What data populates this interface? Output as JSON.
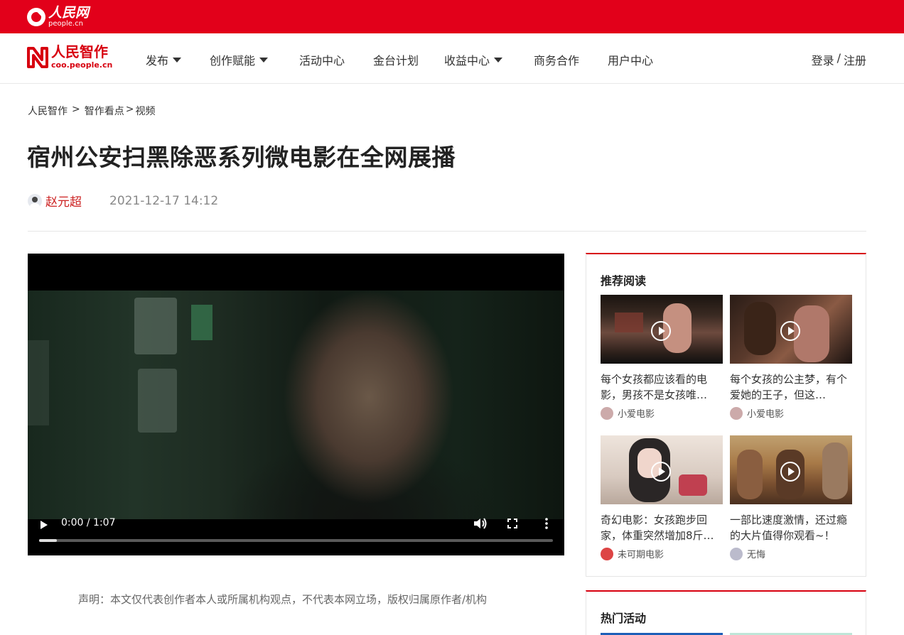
{
  "topbar": {
    "logo_cn": "人民网",
    "logo_en": "people.cn"
  },
  "brand": {
    "cn": "人民智作",
    "en": "coo.people.cn"
  },
  "nav": {
    "items": [
      {
        "label": "发布",
        "dropdown": true
      },
      {
        "label": "创作赋能",
        "dropdown": true
      },
      {
        "label": "活动中心",
        "dropdown": false
      },
      {
        "label": "金台计划",
        "dropdown": false
      },
      {
        "label": "收益中心",
        "dropdown": true
      },
      {
        "label": "商务合作",
        "dropdown": false
      },
      {
        "label": "用户中心",
        "dropdown": false
      }
    ],
    "login": "登录",
    "separator": "/",
    "register": "注册"
  },
  "breadcrumb": {
    "home": "人民智作",
    "sep1": ">",
    "section": "智作看点",
    "sep2": ">",
    "current": "视频"
  },
  "article": {
    "title": "宿州公安扫黑除恶系列微电影在全网展播",
    "author": "赵元超",
    "date": "2021-12-17 14:12",
    "disclaimer": "声明：本文仅代表创作者本人或所属机构观点，不代表本网立场，版权归属原作者/机构"
  },
  "video": {
    "time": "0:00 / 1:07",
    "progress": 0.035
  },
  "sidebar": {
    "recommend_title": "推荐阅读",
    "items": [
      {
        "title": "每个女孩都应该看的电影，男孩不是女孩唯…",
        "author": "小爱电影",
        "avatar_color": "#caa"
      },
      {
        "title": "每个女孩的公主梦，有个爱她的王子，但这…",
        "author": "小爱电影",
        "avatar_color": "#caa"
      },
      {
        "title": "奇幻电影：女孩跑步回家，体重突然增加8斤…",
        "author": "未可期电影",
        "avatar_color": "#d44"
      },
      {
        "title": "一部比速度激情，还过瘾的大片值得你观看~！",
        "author": "无悔",
        "avatar_color": "#bbc"
      }
    ],
    "hot_title": "热门活动"
  },
  "colors": {
    "brand_red": "#e2001a",
    "accent_red": "#d7000f"
  }
}
